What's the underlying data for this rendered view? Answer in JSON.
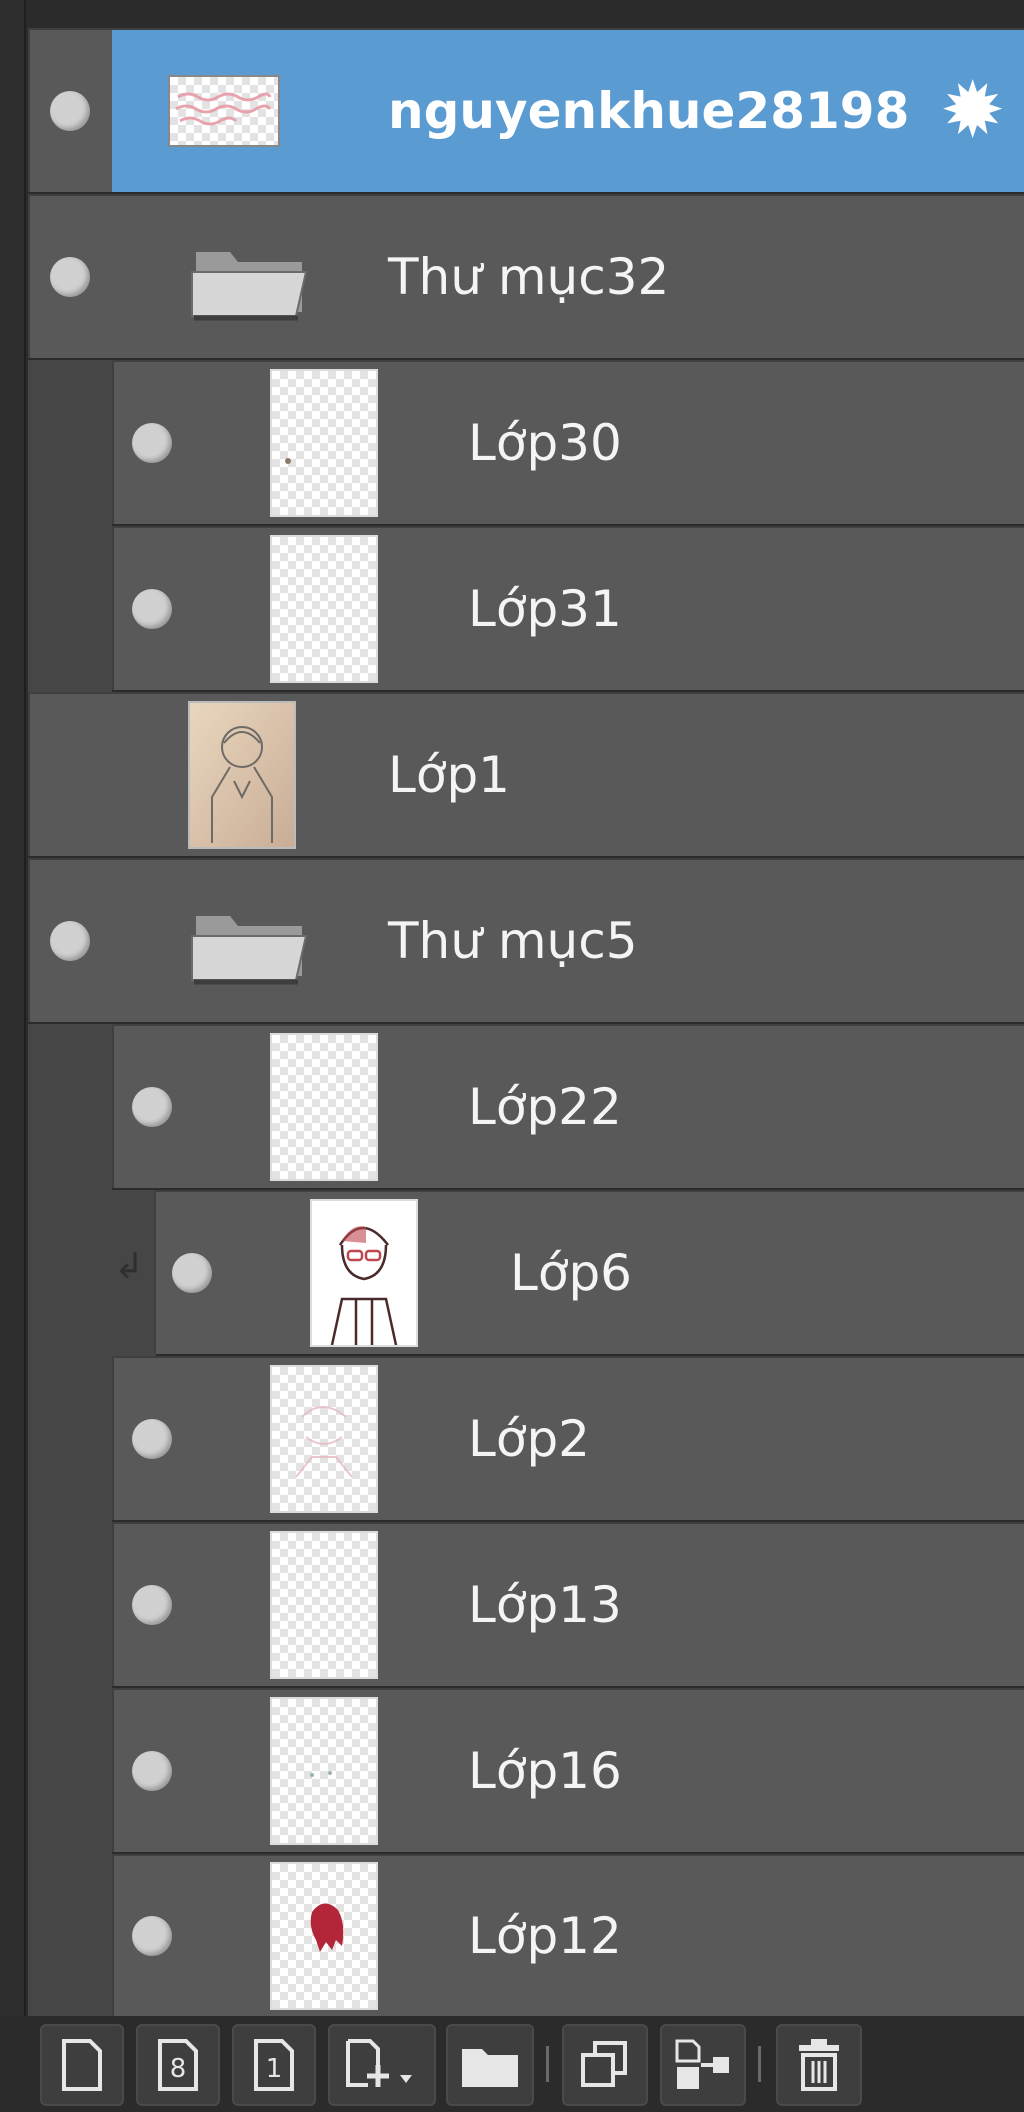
{
  "layers": [
    {
      "label": "nguyenkhue28198",
      "kind": "layer",
      "selected": true,
      "eye": true,
      "thumb": "pink-text-wide",
      "indent": 0
    },
    {
      "label": "Thư mục32",
      "kind": "folder",
      "eye": true,
      "indent": 0
    },
    {
      "label": "Lớp30",
      "kind": "layer",
      "eye": true,
      "thumb": "blank",
      "indent": 1
    },
    {
      "label": "Lớp31",
      "kind": "layer",
      "eye": true,
      "thumb": "blank",
      "indent": 1
    },
    {
      "label": "Lớp1",
      "kind": "layer",
      "eye": false,
      "thumb": "sketch-beige",
      "indent": 0
    },
    {
      "label": "Thư mục5",
      "kind": "folder",
      "eye": true,
      "indent": 0
    },
    {
      "label": "Lớp22",
      "kind": "layer",
      "eye": true,
      "thumb": "blank",
      "indent": 1
    },
    {
      "label": "Lớp6",
      "kind": "layer",
      "eye": true,
      "thumb": "character-lineart",
      "indent": 1,
      "clipped": true
    },
    {
      "label": "Lớp2",
      "kind": "layer",
      "eye": true,
      "thumb": "faint-pink",
      "indent": 1
    },
    {
      "label": "Lớp13",
      "kind": "layer",
      "eye": true,
      "thumb": "blank",
      "indent": 1
    },
    {
      "label": "Lớp16",
      "kind": "layer",
      "eye": true,
      "thumb": "blank",
      "indent": 1
    },
    {
      "label": "Lớp12",
      "kind": "layer",
      "eye": true,
      "thumb": "red-hair",
      "indent": 1
    }
  ],
  "toolbar": {
    "buttons": [
      {
        "icon": "new-layer-icon"
      },
      {
        "icon": "new-8bit-layer-icon",
        "text": "8"
      },
      {
        "icon": "new-1bit-layer-icon",
        "text": "1"
      },
      {
        "icon": "add-layer-dropdown-icon"
      },
      {
        "icon": "new-folder-icon"
      },
      {
        "icon": "duplicate-layer-icon"
      },
      {
        "icon": "merge-down-icon"
      },
      {
        "icon": "delete-layer-icon"
      }
    ]
  },
  "colors": {
    "selected": "#5a9bd1",
    "row": "#595959",
    "background": "#2b2b2b",
    "text": "#f4f4f4"
  }
}
